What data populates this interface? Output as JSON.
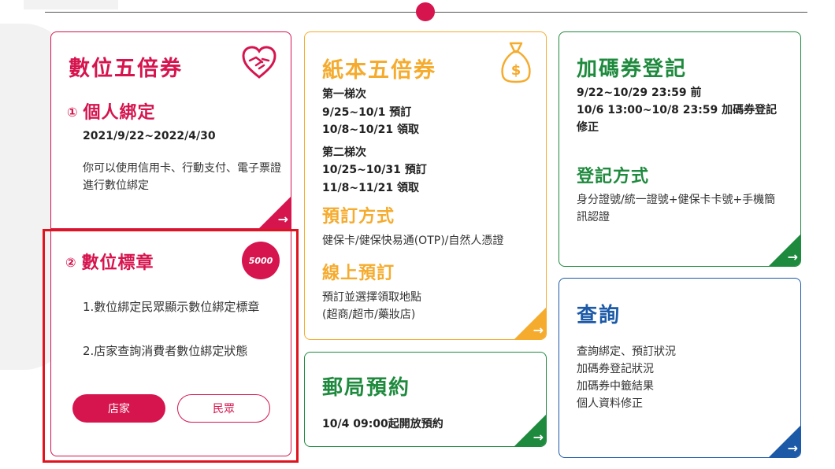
{
  "colors": {
    "digital": "#d6144e",
    "paper": "#f5ab2d",
    "green": "#1e8a3d",
    "blue": "#1c5aa8",
    "highlight": "#e0141e"
  },
  "digital_card": {
    "title": "數位五倍券",
    "icon": "handshake-heart-icon",
    "section1_num": "①",
    "section1_title": "個人綁定",
    "date": "2021/9/22~2022/4/30",
    "desc": "你可以使用信用卡、行動支付、電子票證進行數位綁定"
  },
  "badge_card": {
    "section2_num": "②",
    "section2_title": "數位標章",
    "logo_text": "5000",
    "line1": "1.數位綁定民眾顯示數位綁定標章",
    "line2": "2.店家查詢消費者數位綁定狀態",
    "store_button": "店家",
    "citizen_button": "民眾"
  },
  "paper_card": {
    "title": "紙本五倍券",
    "icon": "money-bag-icon",
    "batch1_label": "第一梯次",
    "batch1_reserve": "9/25~10/1 預訂",
    "batch1_pickup": "10/8~10/21 領取",
    "batch2_label": "第二梯次",
    "batch2_reserve": "10/25~10/31 預訂",
    "batch2_pickup": "11/8~11/21 領取",
    "method_title": "預訂方式",
    "method_body": "健保卡/健保快易通(OTP)/自然人憑證",
    "online_title": "線上預訂",
    "online_body1": "預訂並選擇領取地點",
    "online_body2": "(超商/超市/藥妝店)"
  },
  "post_card": {
    "title": "郵局預約",
    "info": "10/4 09:00起開放預約"
  },
  "bonus_card": {
    "title": "加碼券登記",
    "line1": "9/22~10/29 23:59 前",
    "line2": "10/6 13:00~10/8 23:59 加碼券登記修正",
    "method_title": "登記方式",
    "method_body": "身分證號/統一證號+健保卡卡號+手機簡訊認證"
  },
  "query_card": {
    "title": "查詢",
    "line1": "查詢綁定、預訂狀況",
    "line2": "加碼券登記狀況",
    "line3": "加碼券中籤結果",
    "line4": "個人資料修正"
  },
  "arrow": "→"
}
